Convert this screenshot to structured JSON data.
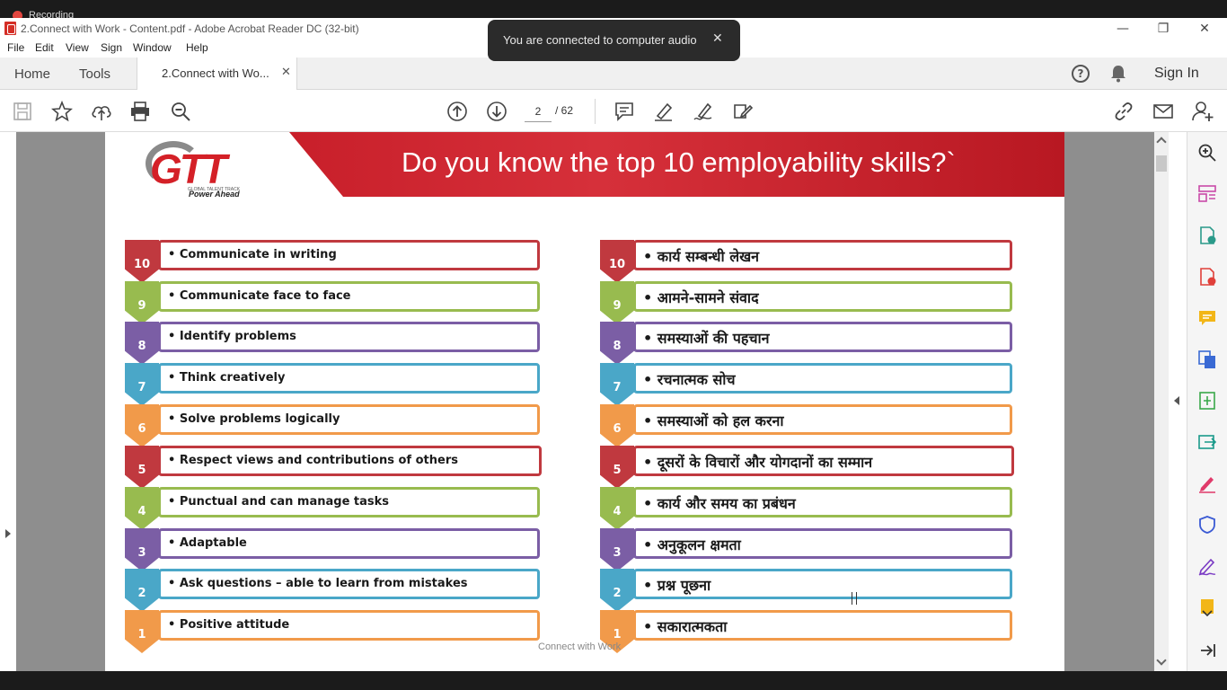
{
  "recording": {
    "label": "Recording"
  },
  "window": {
    "title": "2.Connect with Work - Content.pdf - Adobe Acrobat Reader DC (32-bit)",
    "minimize": "—",
    "restore": "❐",
    "close": "✕"
  },
  "menu": {
    "items": [
      "File",
      "Edit",
      "View",
      "Sign",
      "Window",
      "Help"
    ]
  },
  "tabs": {
    "home": "Home",
    "tools": "Tools",
    "doc": "2.Connect with Wo...",
    "doc_close": "✕",
    "help": "?",
    "sign_in": "Sign In"
  },
  "toolbar": {
    "page_current": "2",
    "page_total": "/ 62"
  },
  "toast": {
    "message": "You are connected to computer audio",
    "close": "✕"
  },
  "slide": {
    "title": "Do you know the top 10 employability skills?`",
    "logo_text": "GTT",
    "logo_small": "GLOBAL TALENT TRACK",
    "logo_tagline": "Power Ahead",
    "footer": "Connect with Work",
    "colors": {
      "red": "#c0393f",
      "green": "#98bb4f",
      "purple": "#7b5ea5",
      "blue": "#4aa7c8",
      "orange": "#f19a4a"
    },
    "english": [
      {
        "num": "10",
        "text": "• Communicate in writing",
        "color": "#c0393f"
      },
      {
        "num": "9",
        "text": "• Communicate face to face",
        "color": "#98bb4f"
      },
      {
        "num": "8",
        "text": "• Identify problems",
        "color": "#7b5ea5"
      },
      {
        "num": "7",
        "text": "• Think creatively",
        "color": "#4aa7c8"
      },
      {
        "num": "6",
        "text": "• Solve problems logically",
        "color": "#f19a4a"
      },
      {
        "num": "5",
        "text": "• Respect views and contributions of others",
        "color": "#c0393f"
      },
      {
        "num": "4",
        "text": "• Punctual and can manage tasks",
        "color": "#98bb4f"
      },
      {
        "num": "3",
        "text": "• Adaptable",
        "color": "#7b5ea5"
      },
      {
        "num": "2",
        "text": "• Ask questions – able to learn from mistakes",
        "color": "#4aa7c8"
      },
      {
        "num": "1",
        "text": "• Positive attitude",
        "color": "#f19a4a"
      }
    ],
    "hindi": [
      {
        "num": "10",
        "text": "• कार्य सम्बन्धी लेखन",
        "color": "#c0393f"
      },
      {
        "num": "9",
        "text": "• आमने-सामने संवाद",
        "color": "#98bb4f"
      },
      {
        "num": "8",
        "text": "• समस्याओं की पहचान",
        "color": "#7b5ea5"
      },
      {
        "num": "7",
        "text": "• रचनात्मक सोच",
        "color": "#4aa7c8"
      },
      {
        "num": "6",
        "text": "• समस्याओं को हल करना",
        "color": "#f19a4a"
      },
      {
        "num": "5",
        "text": "• दूसरों के विचारों और योगदानों का सम्मान",
        "color": "#c0393f"
      },
      {
        "num": "4",
        "text": "• कार्य और समय का प्रबंधन",
        "color": "#98bb4f"
      },
      {
        "num": "3",
        "text": "• अनुकूलन क्षमता",
        "color": "#7b5ea5"
      },
      {
        "num": "2",
        "text": "• प्रश्न पूछना",
        "color": "#4aa7c8"
      },
      {
        "num": "1",
        "text": "• सकारात्मकता",
        "color": "#f19a4a"
      }
    ]
  }
}
